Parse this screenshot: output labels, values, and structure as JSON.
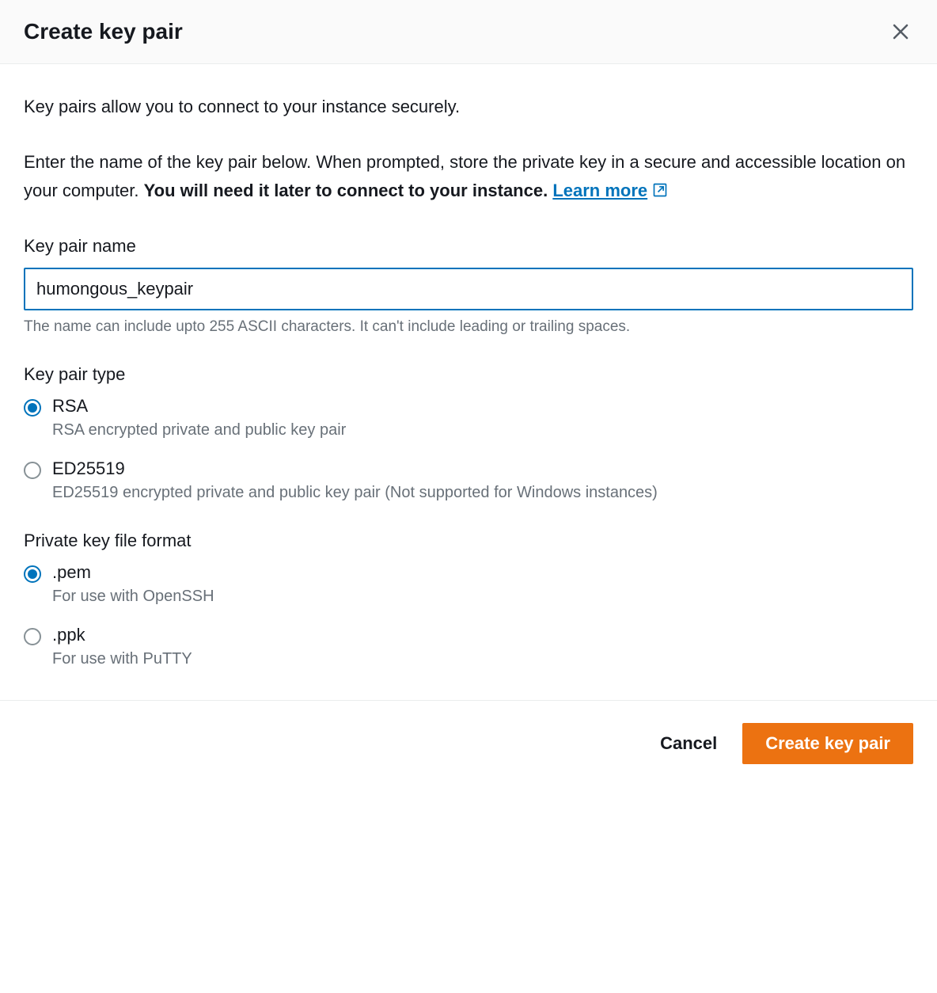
{
  "header": {
    "title": "Create key pair"
  },
  "intro": {
    "line1": "Key pairs allow you to connect to your instance securely.",
    "line2_part1": "Enter the name of the key pair below. When prompted, store the private key in a secure and accessible location on your computer. ",
    "line2_bold": "You will need it later to connect to your instance.",
    "learn_more": "Learn more"
  },
  "name_section": {
    "label": "Key pair name",
    "value": "humongous_keypair",
    "helper": "The name can include upto 255 ASCII characters. It can't include leading or trailing spaces."
  },
  "type_section": {
    "label": "Key pair type",
    "options": [
      {
        "label": "RSA",
        "description": "RSA encrypted private and public key pair",
        "selected": true
      },
      {
        "label": "ED25519",
        "description": "ED25519 encrypted private and public key pair (Not supported for Windows instances)",
        "selected": false
      }
    ]
  },
  "format_section": {
    "label": "Private key file format",
    "options": [
      {
        "label": ".pem",
        "description": "For use with OpenSSH",
        "selected": true
      },
      {
        "label": ".ppk",
        "description": "For use with PuTTY",
        "selected": false
      }
    ]
  },
  "footer": {
    "cancel": "Cancel",
    "submit": "Create key pair"
  }
}
